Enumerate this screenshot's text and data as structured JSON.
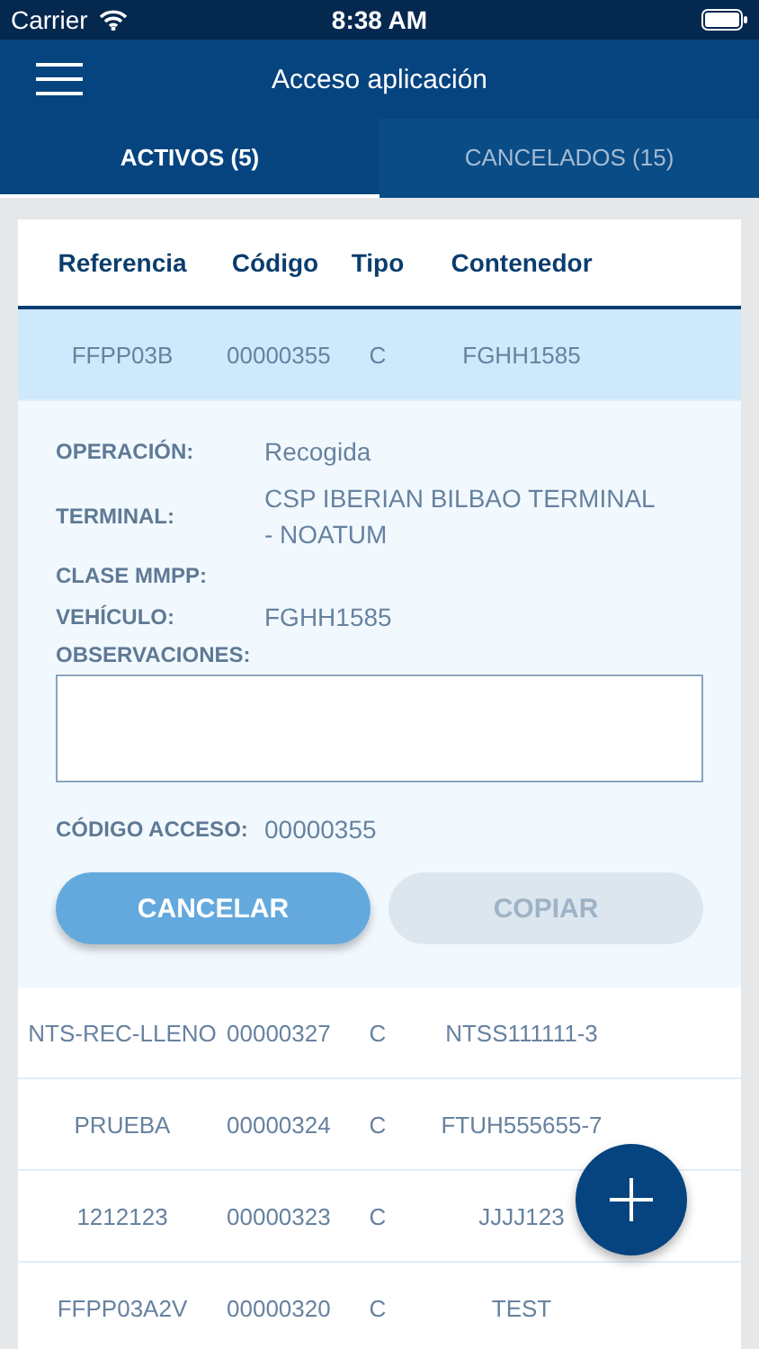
{
  "status_bar": {
    "carrier": "Carrier",
    "time": "8:38 AM"
  },
  "header": {
    "title": "Acceso aplicación"
  },
  "tabs": [
    {
      "label": "ACTIVOS (5)",
      "selected": true
    },
    {
      "label": "CANCELADOS (15)",
      "selected": false
    }
  ],
  "table": {
    "columns": [
      "Referencia",
      "Código",
      "Tipo",
      "Contenedor"
    ],
    "rows": [
      {
        "cells": [
          "FFPP03B",
          "00000355",
          "C",
          "FGHH1585"
        ],
        "selected": true,
        "expanded": true
      },
      {
        "cells": [
          "NTS-REC-LLENO",
          "00000327",
          "C",
          "NTSS111111-3"
        ],
        "selected": false,
        "expanded": false
      },
      {
        "cells": [
          "PRUEBA",
          "00000324",
          "C",
          "FTUH555655-7"
        ],
        "selected": false,
        "expanded": false
      },
      {
        "cells": [
          "1212123",
          "00000323",
          "C",
          "JJJJ123"
        ],
        "selected": false,
        "expanded": false
      },
      {
        "cells": [
          "FFPP03A2V",
          "00000320",
          "C",
          "TEST"
        ],
        "selected": false,
        "expanded": false
      }
    ]
  },
  "details": {
    "fields": [
      {
        "label": "OPERACIÓN:",
        "value": "Recogida"
      },
      {
        "label": "TERMINAL:",
        "value": "CSP IBERIAN BILBAO TERMINAL - NOATUM"
      },
      {
        "label": "CLASE MMPP:"
      },
      {
        "label": "VEHÍCULO:",
        "value": "FGHH1585"
      }
    ],
    "observations": {
      "label": "OBSERVACIONES:"
    },
    "access_code": {
      "label": "CÓDIGO ACCESO:",
      "value": "00000355"
    },
    "buttons": [
      {
        "label": "CANCELAR",
        "disabled": false
      },
      {
        "label": "COPIAR",
        "disabled": true
      }
    ]
  }
}
